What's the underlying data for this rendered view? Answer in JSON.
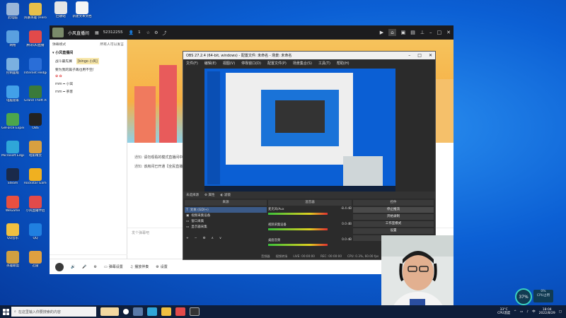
{
  "desktop": {
    "icons": [
      {
        "label": "此电脑"
      },
      {
        "label": "风暴英雄 (HeroSpoon)"
      },
      {
        "label": "网络"
      },
      {
        "label": "腾讯QQ直播"
      },
      {
        "label": "控制面板"
      },
      {
        "label": "Internet Hedgehog"
      },
      {
        "label": "电脑管家"
      },
      {
        "label": "Grand Theft Auto V"
      },
      {
        "label": "GeForce Experience"
      },
      {
        "label": "OBS"
      },
      {
        "label": "Microsoft Edge"
      },
      {
        "label": "暗影精灵"
      },
      {
        "label": "Steam"
      },
      {
        "label": "Rockstar Games Launcher"
      },
      {
        "label": "WeGame"
      },
      {
        "label": "小风直播伴侣"
      },
      {
        "label": "QQ音乐"
      },
      {
        "label": "QQ"
      },
      {
        "label": "英雄联盟"
      },
      {
        "label": "迅雷"
      }
    ],
    "top_icons": [
      {
        "label": "回收站"
      },
      {
        "label": "记事本"
      },
      {
        "label": "新建文本文档"
      }
    ]
  },
  "app": {
    "streamer": "小风直播间",
    "room_id": "52312255",
    "fans": "1",
    "chat": {
      "mode_label": "弹幕模式",
      "all_label": "所有人可以发言",
      "section_title": "小风直播间",
      "welcome": "战斗最先赛",
      "lines": [
        "要为我的篇子再也用不空/",
        "✿ ✿",
        "ｍｍ ━ 小窝",
        "ｍｍ ━ 茶客"
      ],
      "badge_text": "[bingo 小风]"
    },
    "messages": [
      {
        "tag": "通知:",
        "text": "请勿观看的模式直播间中"
      },
      {
        "tag": "通知:",
        "text": "该房间已开通【全民直播】"
      }
    ],
    "input_placeholder": "发个弹幕吧",
    "toolbar": [
      {
        "label": "弹幕设置"
      },
      {
        "label": "播放伴奏"
      },
      {
        "label": "设置"
      }
    ]
  },
  "obs": {
    "title": "OBS 27.2.4 (64-bit, windows) - 配置文件: 未命名 - 场景: 未命名",
    "menu": [
      "文件(F)",
      "编辑(E)",
      "视图(V)",
      "停靠窗口(D)",
      "配置文件(P)",
      "场景集合(S)",
      "工具(T)",
      "帮助(H)"
    ],
    "bar": [
      "未选择源",
      "属性",
      "滤镜"
    ],
    "docks": {
      "sources": "来源",
      "mixer": "混音器",
      "controls": "控件"
    },
    "sources": [
      {
        "name": "文本 (GDI+)"
      },
      {
        "name": "视频采集设备"
      },
      {
        "name": "窗口采集"
      },
      {
        "name": "显示器采集"
      }
    ],
    "mixer": [
      {
        "name": "麦克风/Aux",
        "level": "-8.4 dB"
      },
      {
        "name": "视频采集设备",
        "level": "0.0 dB"
      },
      {
        "name": "桌面音频",
        "level": "0.0 dB"
      }
    ],
    "mixer_tabs": [
      "音频器",
      "视频转场"
    ],
    "controls": [
      "停止推流",
      "开始录制",
      "工作室模式",
      "设置",
      "退出"
    ],
    "status": [
      "LIVE: 00:00:00",
      "REC: 00:00:00",
      "CPU: 0.3%, 60.00 fps"
    ]
  },
  "taskbar": {
    "search_placeholder": "在这里输入你要搜索的内容",
    "temp": "33°C",
    "cpu_temp_label": "CPU温度",
    "time": "18:04",
    "date": "2022/8/29",
    "ime": "中",
    "cpu_percent": "37%",
    "cpu_label_top": "0%",
    "cpu_label_bottom": "CPU占用"
  }
}
